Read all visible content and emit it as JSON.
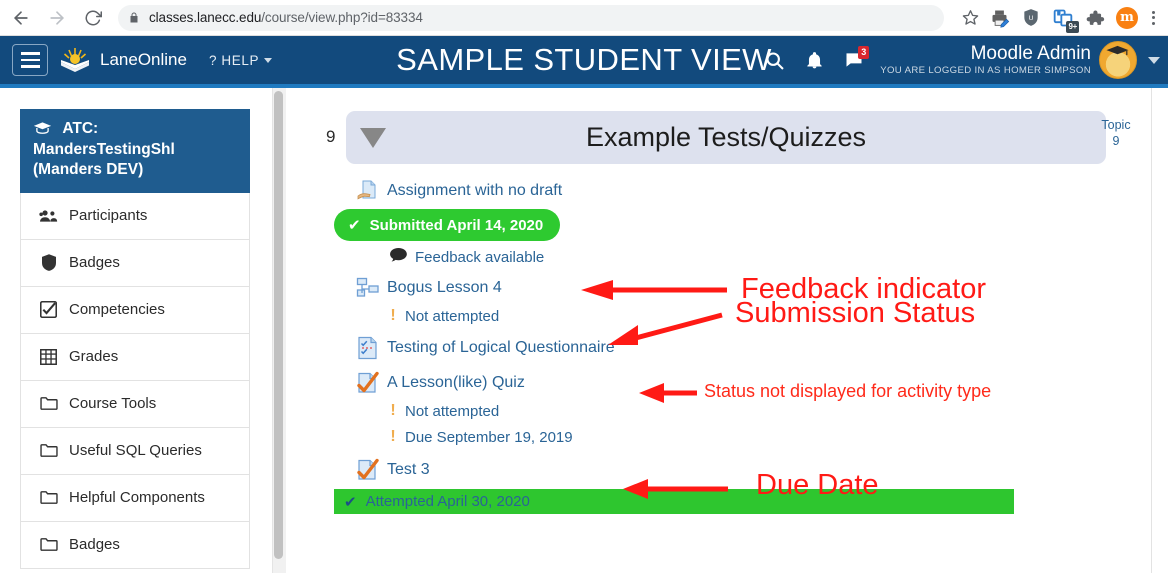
{
  "browser": {
    "url_domain": "classes.lanecc.edu",
    "url_path": "/course/view.php?id=83334",
    "back_icon": "back-arrow-icon",
    "forward_icon": "forward-arrow-icon",
    "reload_icon": "reload-icon",
    "lock_icon": "lock-icon",
    "star_icon": "star-icon",
    "extensions": [
      {
        "name": "printer-extension-icon"
      },
      {
        "name": "shield-extension-icon"
      },
      {
        "name": "tabs-extension-icon",
        "badge": "9+"
      },
      {
        "name": "puzzle-extensions-icon"
      },
      {
        "name": "moodle-extension-icon",
        "letter": "m"
      }
    ],
    "menu_icon": "chrome-menu-icon"
  },
  "navbar": {
    "menu_icon": "hamburger-menu-icon",
    "logo_icon": "laneonline-sunrise-logo",
    "brand": "LaneOnline",
    "help_label": "? HELP",
    "site_title": "SAMPLE STUDENT VIEW",
    "search_icon": "search-icon",
    "bell_icon": "notifications-bell-icon",
    "messages_icon": "messages-icon",
    "messages_badge": "3",
    "user_name": "Moodle Admin",
    "logged_in_as": "YOU ARE LOGGED IN AS HOMER SIMPSON",
    "avatar_icon": "user-avatar",
    "user_menu_caret": "chevron-down-icon",
    "brand_color": "#124a7d",
    "accent_color": "#1f7ac0"
  },
  "sidebar": {
    "course_title": "ATC: MandersTestingShl (Manders DEV)",
    "course_icon": "graduation-cap-icon",
    "items": [
      {
        "label": "Participants",
        "icon": "participants-icon"
      },
      {
        "label": "Badges",
        "icon": "badge-shield-icon"
      },
      {
        "label": "Competencies",
        "icon": "competencies-checkbox-icon"
      },
      {
        "label": "Grades",
        "icon": "grades-table-icon"
      },
      {
        "label": "Course Tools",
        "icon": "folder-icon"
      },
      {
        "label": "Useful SQL Queries",
        "icon": "folder-icon"
      },
      {
        "label": "Helpful Components",
        "icon": "folder-icon"
      },
      {
        "label": "Badges",
        "icon": "folder-icon"
      }
    ]
  },
  "section": {
    "number": "9",
    "title": "Example Tests/Quizzes",
    "collapse_icon": "collapse-triangle-icon",
    "topic_label": "Topic",
    "topic_number": "9",
    "header_bg": "#dde1ee"
  },
  "activities": [
    {
      "name": "Assignment with no draft",
      "icon": "assignment-icon",
      "completion": {
        "style": "dashed",
        "checked": true
      },
      "pill": {
        "text": "Submitted April 14, 2020",
        "icon": "check-icon",
        "color": "#2eca30"
      },
      "feedback": {
        "text": "Feedback available",
        "icon": "comment-bubble-icon"
      }
    },
    {
      "name": "Bogus Lesson 4",
      "icon": "lesson-icon",
      "completion": {
        "style": "solid",
        "checked": false
      },
      "statuses": [
        {
          "text": "Not attempted",
          "icon": "warning-bang-icon"
        }
      ]
    },
    {
      "name": "Testing of Logical Questionnaire",
      "icon": "questionnaire-icon",
      "completion": {
        "style": "dashed",
        "checked": false
      },
      "statuses": []
    },
    {
      "name": "A Lesson(like) Quiz",
      "icon": "quiz-icon",
      "completion": {
        "style": "dashed",
        "checked": false
      },
      "statuses": [
        {
          "text": "Not attempted",
          "icon": "warning-bang-icon"
        },
        {
          "text": "Due September 19, 2019",
          "icon": "warning-bang-icon"
        }
      ]
    },
    {
      "name": "Test 3",
      "icon": "quiz-icon",
      "completion": {
        "style": "dashed",
        "checked": false
      },
      "bar": {
        "text": "Attempted April 30, 2020",
        "icon": "check-icon",
        "color": "#2ec62f"
      }
    }
  ],
  "annotations": [
    {
      "text": "Submission Status",
      "size": "large"
    },
    {
      "text": "Feedback indicator",
      "size": "large"
    },
    {
      "text": "Status not displayed for activity type",
      "size": "small"
    },
    {
      "text": "Due Date",
      "size": "large"
    }
  ]
}
